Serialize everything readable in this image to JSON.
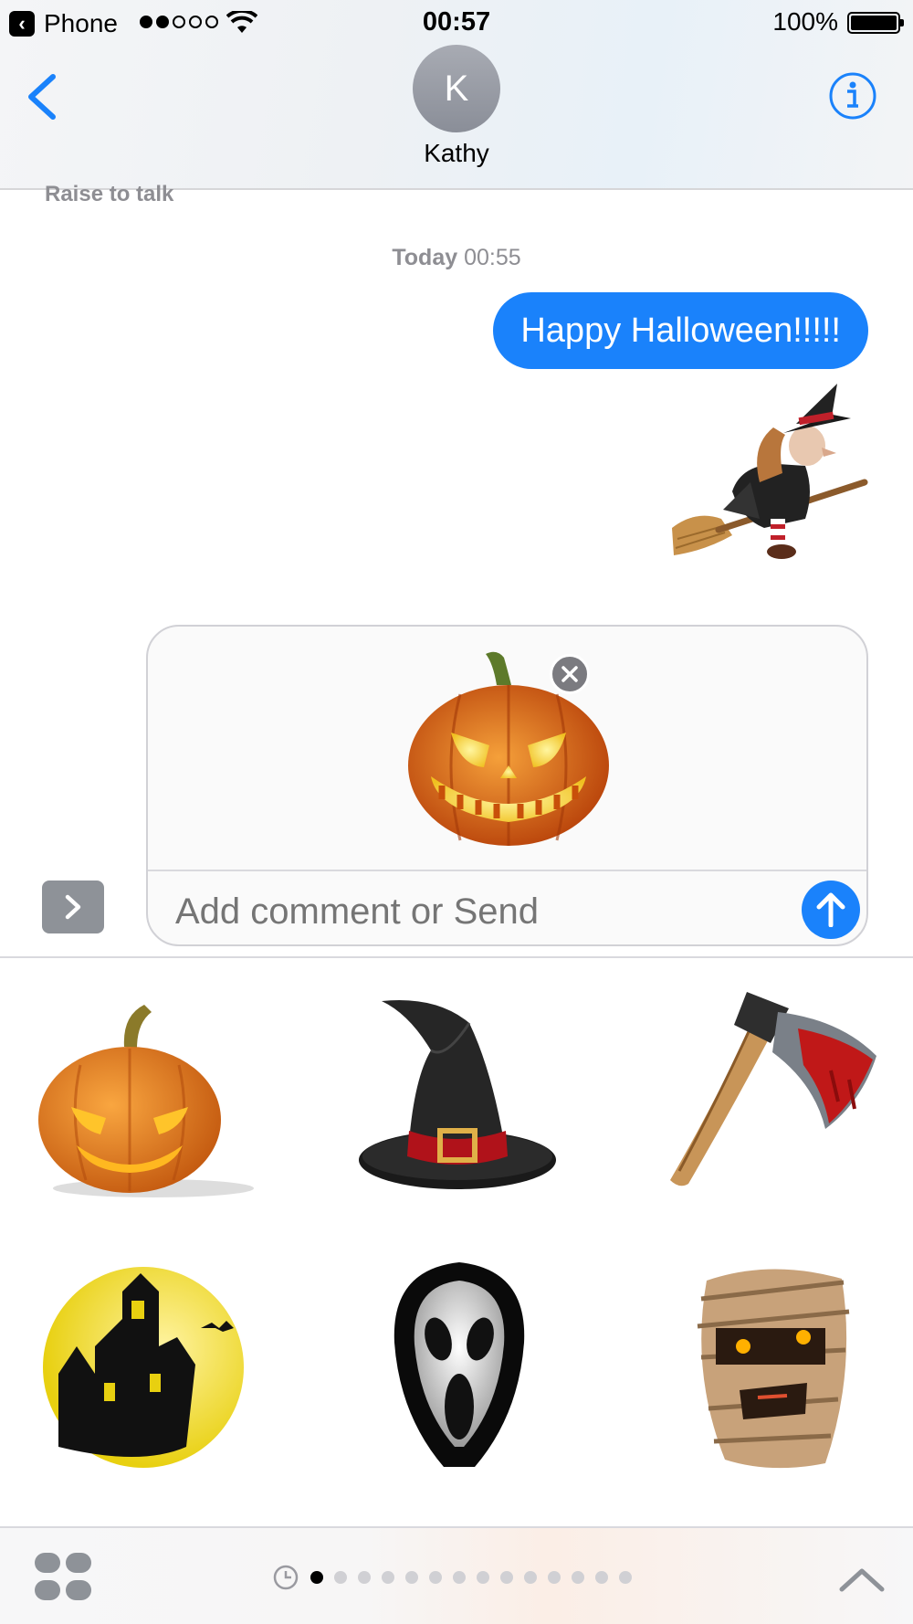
{
  "status_bar": {
    "back_app_label": "Phone",
    "signal_bars_filled": 2,
    "signal_bars_total": 5,
    "time": "00:57",
    "battery_percent": "100%"
  },
  "header": {
    "contact_initial": "K",
    "contact_name": "Kathy",
    "back_icon": "chevron-left-icon",
    "info_icon": "info-icon"
  },
  "conversation": {
    "raise_to_talk": "Raise to talk",
    "timestamp_day": "Today",
    "timestamp_time": "00:55",
    "messages": [
      {
        "type": "text",
        "from": "me",
        "text": "Happy Halloween!!!!!"
      },
      {
        "type": "sticker",
        "from": "me",
        "sticker": "witch-on-broom"
      }
    ]
  },
  "compose": {
    "attached_sticker": "jack-o-lantern",
    "placeholder": "Add comment or Send",
    "send_icon": "arrow-up-icon",
    "remove_icon": "close-icon",
    "expand_icon": "chevron-right-icon"
  },
  "sticker_drawer": {
    "stickers": [
      "pumpkin",
      "witch-hat",
      "bloody-axe",
      "haunted-house",
      "scream-mask",
      "mummy"
    ]
  },
  "bottom_bar": {
    "apps_icon": "app-drawer-icon",
    "recents_icon": "clock-icon",
    "page_count": 14,
    "active_page": 1,
    "collapse_icon": "chevron-up-icon"
  },
  "colors": {
    "accent": "#1a82fb",
    "avatar": "#9a9da5",
    "secondary_text": "#8e8e93"
  }
}
